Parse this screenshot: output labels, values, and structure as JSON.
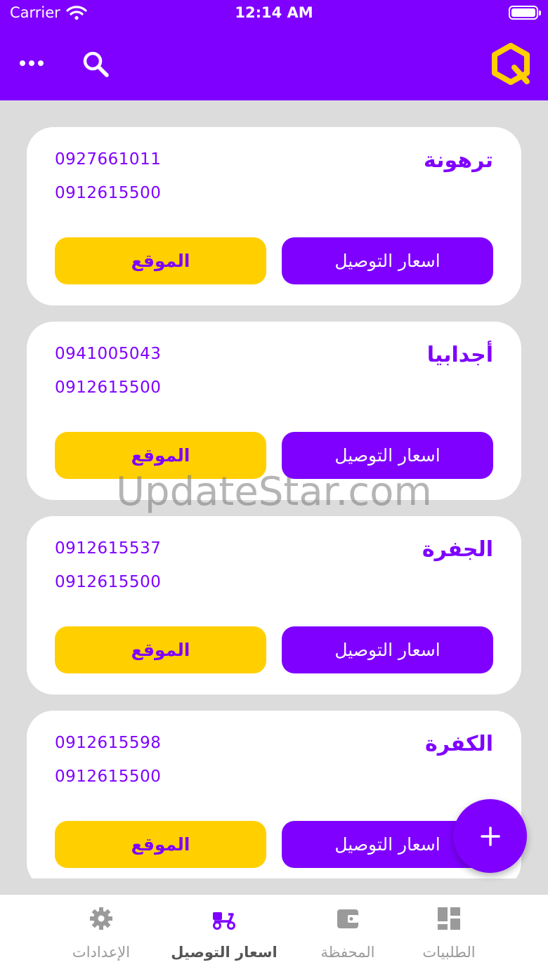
{
  "status_bar": {
    "carrier": "Carrier",
    "time": "12:14 AM"
  },
  "colors": {
    "brand": "#7f00ff",
    "accent": "#ffcf00",
    "background": "#dcdcdc"
  },
  "header": {
    "more_icon": "more-horizontal-icon",
    "search_icon": "search-icon",
    "logo_icon": "app-logo-icon"
  },
  "branches": [
    {
      "city": "ترهونة",
      "phone1": "0927661011",
      "phone2": "0912615500",
      "price_label": "اسعار التوصيل",
      "location_label": "الموقع"
    },
    {
      "city": "أجدابيا",
      "phone1": "0941005043",
      "phone2": "0912615500",
      "price_label": "اسعار التوصيل",
      "location_label": "الموقع"
    },
    {
      "city": "الجفرة",
      "phone1": "0912615537",
      "phone2": "0912615500",
      "price_label": "اسعار التوصيل",
      "location_label": "الموقع"
    },
    {
      "city": "الكفرة",
      "phone1": "0912615598",
      "phone2": "0912615500",
      "price_label": "اسعار التوصيل",
      "location_label": "الموقع"
    }
  ],
  "fab": {
    "icon": "plus-icon"
  },
  "watermark": "UpdateStar.com",
  "tabs": [
    {
      "label": "الإعدادات",
      "icon": "gear-icon",
      "active": false
    },
    {
      "label": "اسعار التوصيل",
      "icon": "delivery-scooter-icon",
      "active": true
    },
    {
      "label": "المحفظة",
      "icon": "wallet-icon",
      "active": false
    },
    {
      "label": "الطلبيات",
      "icon": "dashboard-icon",
      "active": false
    }
  ]
}
